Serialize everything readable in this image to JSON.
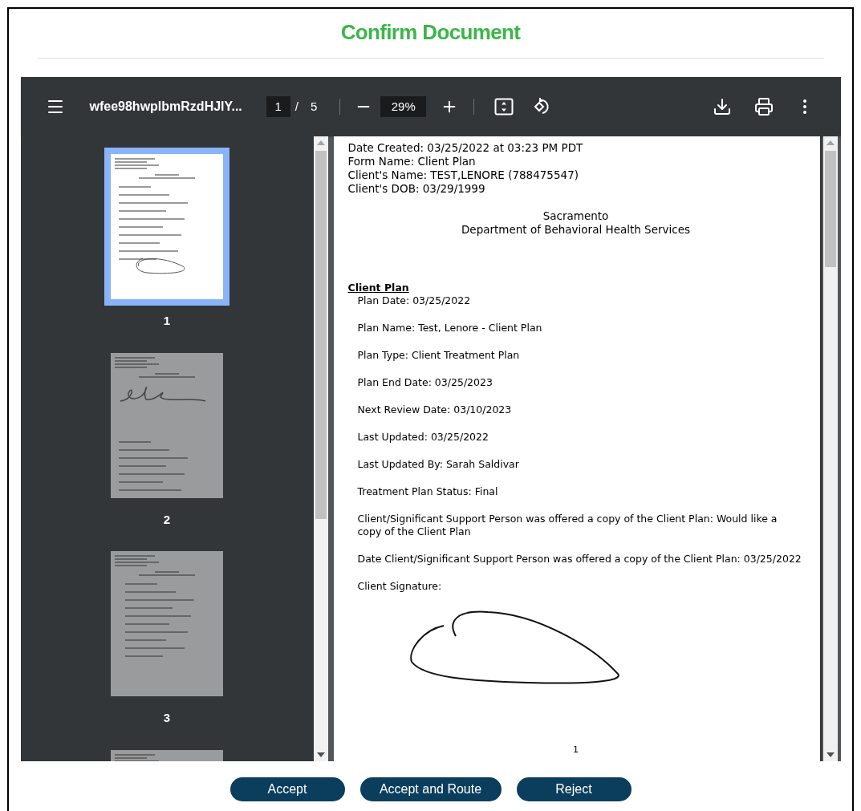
{
  "title": "Confirm Document",
  "viewer": {
    "file_name": "wfee98hwplbmRzdHJlY...",
    "page_current": "1",
    "page_separator": "/",
    "page_total": "5",
    "zoom": "29%",
    "thumbnails": [
      {
        "label": "1",
        "selected": true,
        "kind": "loop"
      },
      {
        "label": "2",
        "selected": false,
        "kind": "wave"
      },
      {
        "label": "3",
        "selected": false,
        "kind": "list"
      },
      {
        "selected": false,
        "kind": "list"
      }
    ],
    "document": {
      "header_lines": [
        "Date Created: 03/25/2022 at 03:23 PM PDT",
        "Form Name: Client Plan",
        "Client's Name: TEST,LENORE (788475547)",
        "Client's DOB: 03/29/1999"
      ],
      "org_lines": [
        "Sacramento",
        "Department of Behavioral Health Services"
      ],
      "section_title": "Client Plan",
      "fields": [
        "Plan Date: 03/25/2022",
        "Plan Name: Test, Lenore - Client Plan",
        "Plan Type: Client Treatment Plan",
        "Plan End Date: 03/25/2023",
        "Next Review Date: 03/10/2023",
        "Last Updated: 03/25/2022",
        "Last Updated By: Sarah Saldivar",
        "Treatment Plan Status: Final",
        "Client/Significant Support Person was offered a copy of the Client Plan: Would like a copy of the Client Plan",
        "Date Client/Significant Support Person was offered a copy of the Client Plan: 03/25/2022",
        "Client Signature:"
      ],
      "page_number": "1"
    }
  },
  "buttons": [
    "Accept",
    "Accept and Route",
    "Reject"
  ]
}
